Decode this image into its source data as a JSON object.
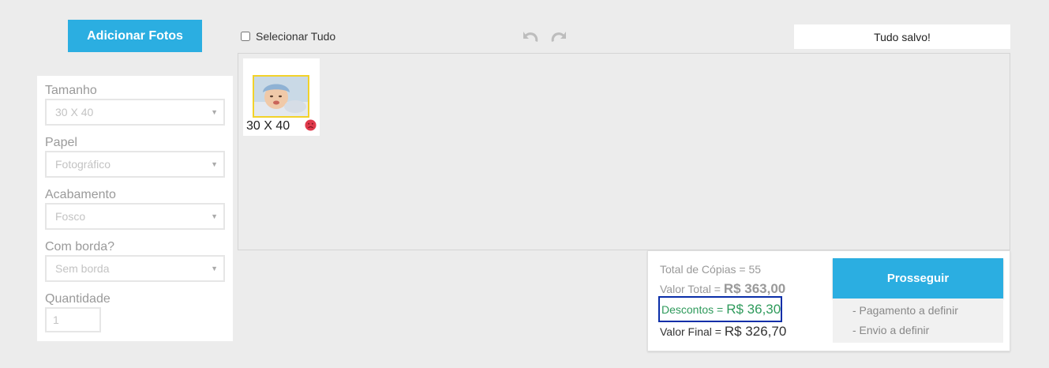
{
  "toolbar": {
    "add_photos_label": "Adicionar Fotos",
    "select_all_label": "Selecionar Tudo",
    "save_status": "Tudo salvo!",
    "undo_icon": "undo-arrow-icon",
    "redo_icon": "redo-arrow-icon"
  },
  "options": {
    "size": {
      "label": "Tamanho",
      "value": "30 X 40"
    },
    "paper": {
      "label": "Papel",
      "value": "Fotográfico"
    },
    "finish": {
      "label": "Acabamento",
      "value": "Fosco"
    },
    "border": {
      "label": "Com borda?",
      "value": "Sem borda"
    },
    "quantity": {
      "label": "Quantidade",
      "value": "1"
    }
  },
  "photos": [
    {
      "size": "30 X 40",
      "status_icon": "sad-face-icon"
    }
  ],
  "summary": {
    "copies_text": "Total de Cópias = 55",
    "total_label": "Valor Total =",
    "total_value": "R$ 363,00",
    "discount_label": "Descontos =",
    "discount_value": "R$ 36,30",
    "final_label": "Valor Final =",
    "final_value": "R$ 326,70",
    "proceed_label": "Prosseguir",
    "payment_status": "- Pagamento a definir",
    "shipping_status": "- Envio a definir"
  },
  "colors": {
    "accent": "#2baee1",
    "discount_text": "#2e9a5b",
    "highlight_border": "#0a2ea8",
    "photo_border": "#f2d22a",
    "error_icon": "#e03a4b"
  }
}
